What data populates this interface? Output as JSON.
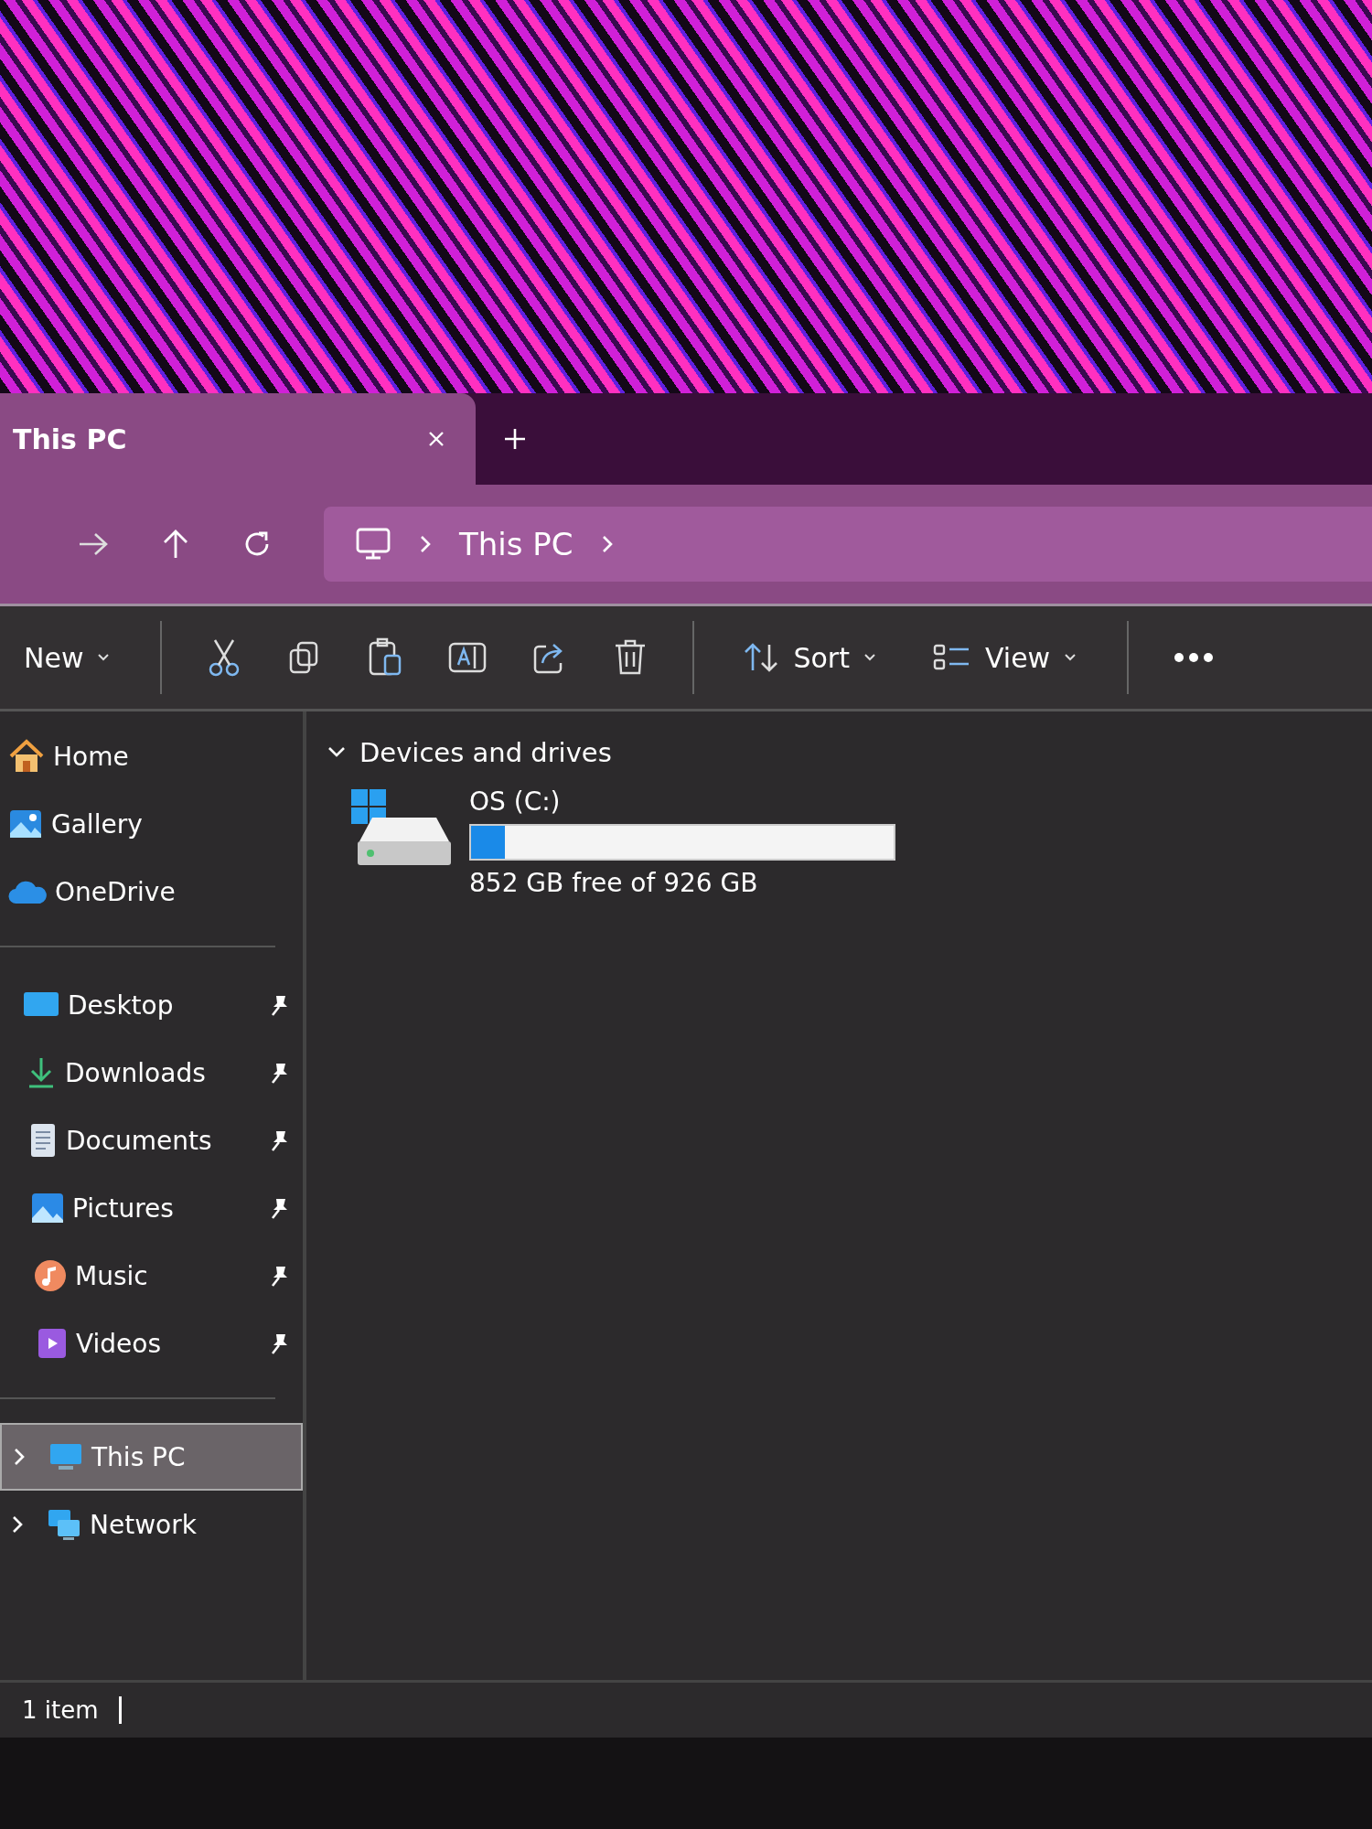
{
  "tab": {
    "title": "This PC",
    "selected": true
  },
  "address": {
    "crumbs": [
      "This PC"
    ]
  },
  "toolbar": {
    "new_label": "New",
    "sort_label": "Sort",
    "view_label": "View"
  },
  "sidebar": {
    "sections": [
      {
        "items": [
          {
            "label": "Home",
            "kind": "home",
            "pinned": false,
            "selected": false
          },
          {
            "label": "Gallery",
            "kind": "gallery",
            "pinned": false,
            "selected": false
          },
          {
            "label": "OneDrive",
            "kind": "cloud",
            "pinned": false,
            "selected": false
          }
        ]
      },
      {
        "items": [
          {
            "label": "Desktop",
            "kind": "desktop",
            "pinned": true,
            "selected": false
          },
          {
            "label": "Downloads",
            "kind": "download",
            "pinned": true,
            "selected": false
          },
          {
            "label": "Documents",
            "kind": "document",
            "pinned": true,
            "selected": false
          },
          {
            "label": "Pictures",
            "kind": "picture",
            "pinned": true,
            "selected": false
          },
          {
            "label": "Music",
            "kind": "music",
            "pinned": true,
            "selected": false
          },
          {
            "label": "Videos",
            "kind": "video",
            "pinned": true,
            "selected": false
          }
        ]
      },
      {
        "items": [
          {
            "label": "This PC",
            "kind": "pc",
            "expanded": false,
            "selected": true
          },
          {
            "label": "Network",
            "kind": "network",
            "expanded": false,
            "selected": false
          }
        ]
      }
    ]
  },
  "section": {
    "title": "Devices and drives",
    "expanded": true
  },
  "drives": [
    {
      "name": "OS (C:)",
      "level": 0.08,
      "free": "852 GB free of 926 GB"
    }
  ],
  "status_bar": {
    "count": "1 item"
  }
}
